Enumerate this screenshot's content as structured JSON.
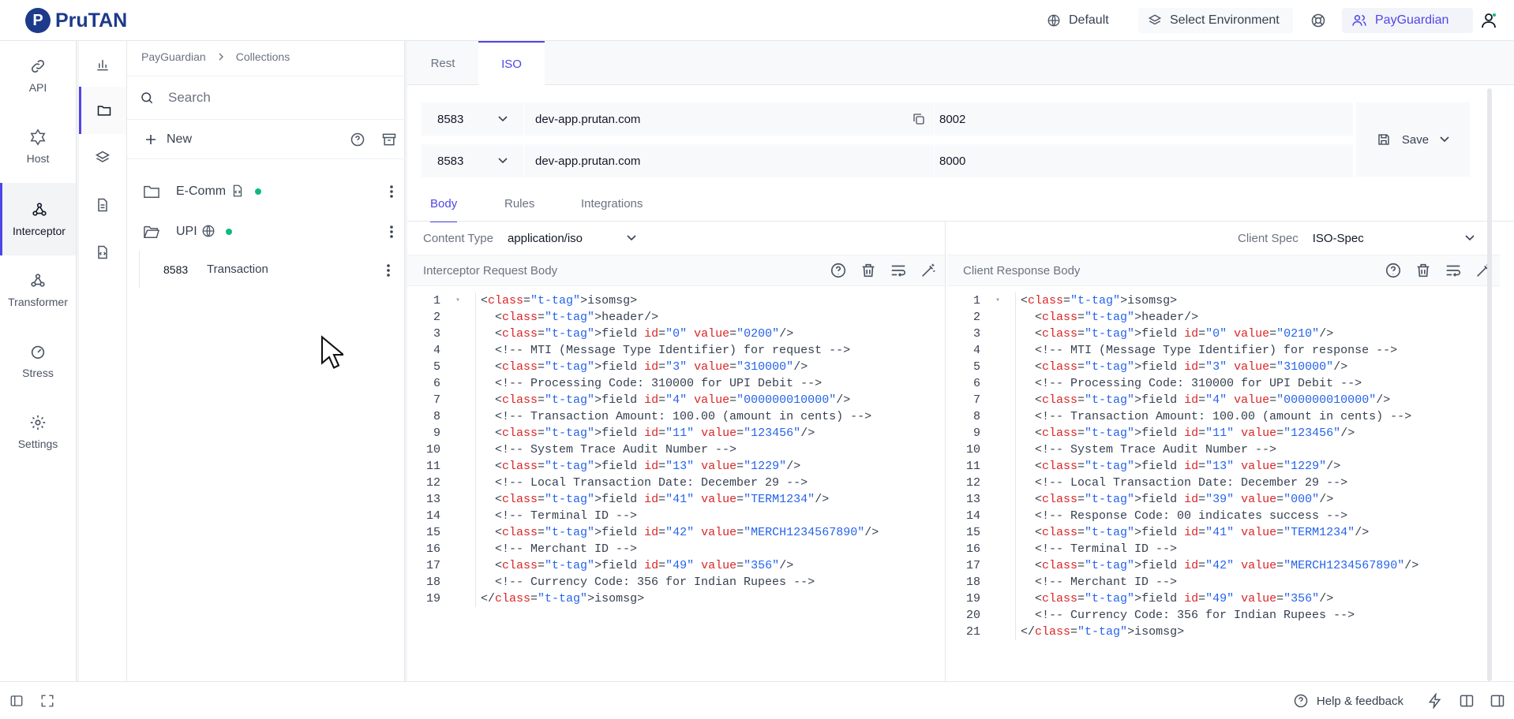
{
  "topbar": {
    "logo_text": "PruTAN",
    "logo_mark": "P",
    "default_label": "Default",
    "environment_label": "Select Environment",
    "workspace_label": "PayGuardian"
  },
  "leftnav": [
    {
      "label": "API",
      "icon": "link-icon"
    },
    {
      "label": "Host",
      "icon": "host-icon"
    },
    {
      "label": "Interceptor",
      "icon": "interceptor-icon"
    },
    {
      "label": "Transformer",
      "icon": "transformer-icon"
    },
    {
      "label": "Stress",
      "icon": "gauge-icon"
    },
    {
      "label": "Settings",
      "icon": "gear-icon"
    }
  ],
  "collections": {
    "breadcrumb": [
      "PayGuardian",
      "Collections"
    ],
    "search_placeholder": "Search",
    "new_label": "New",
    "items": [
      {
        "name": "E-Comm"
      },
      {
        "name": "UPI"
      }
    ],
    "child": {
      "port": "8583",
      "name": "Transaction"
    }
  },
  "protocol_tabs": [
    "Rest",
    "ISO"
  ],
  "interceptor": {
    "port": "8583",
    "host": "dev-app.prutan.com",
    "target_port": "8002"
  },
  "client": {
    "port": "8583",
    "host": "dev-app.prutan.com",
    "target_port": "8000"
  },
  "save_label": "Save",
  "sub_tabs": [
    "Body",
    "Rules",
    "Integrations"
  ],
  "content_type_label": "Content Type",
  "content_type_value": "application/iso",
  "client_spec_label": "Client Spec",
  "client_spec_value": "ISO-Spec",
  "request_panel_title": "Interceptor Request Body",
  "response_panel_title": "Client Response Body",
  "request_body": [
    "<isomsg>",
    "  <header/>",
    "  <field id=\"0\" value=\"0200\"/>",
    "  <!-- MTI (Message Type Identifier) for request -->",
    "  <field id=\"3\" value=\"310000\"/>",
    "  <!-- Processing Code: 310000 for UPI Debit -->",
    "  <field id=\"4\" value=\"000000010000\"/>",
    "  <!-- Transaction Amount: 100.00 (amount in cents) -->",
    "  <field id=\"11\" value=\"123456\"/>",
    "  <!-- System Trace Audit Number -->",
    "  <field id=\"13\" value=\"1229\"/>",
    "  <!-- Local Transaction Date: December 29 -->",
    "  <field id=\"41\" value=\"TERM1234\"/>",
    "  <!-- Terminal ID -->",
    "  <field id=\"42\" value=\"MERCH1234567890\"/>",
    "  <!-- Merchant ID -->",
    "  <field id=\"49\" value=\"356\"/>",
    "  <!-- Currency Code: 356 for Indian Rupees -->",
    "</isomsg>"
  ],
  "response_body": [
    "<isomsg>",
    "  <header/>",
    "  <field id=\"0\" value=\"0210\"/>",
    "  <!-- MTI (Message Type Identifier) for response -->",
    "  <field id=\"3\" value=\"310000\"/>",
    "  <!-- Processing Code: 310000 for UPI Debit -->",
    "  <field id=\"4\" value=\"000000010000\"/>",
    "  <!-- Transaction Amount: 100.00 (amount in cents) -->",
    "  <field id=\"11\" value=\"123456\"/>",
    "  <!-- System Trace Audit Number -->",
    "  <field id=\"13\" value=\"1229\"/>",
    "  <!-- Local Transaction Date: December 29 -->",
    "  <field id=\"39\" value=\"000\"/>",
    "  <!-- Response Code: 00 indicates success -->",
    "  <field id=\"41\" value=\"TERM1234\"/>",
    "  <!-- Terminal ID -->",
    "  <field id=\"42\" value=\"MERCH1234567890\"/>",
    "  <!-- Merchant ID -->",
    "  <field id=\"49\" value=\"356\"/>",
    "  <!-- Currency Code: 356 for Indian Rupees -->",
    "</isomsg>"
  ],
  "footer": {
    "help_label": "Help & feedback"
  },
  "colors": {
    "accent": "#4f46e5",
    "brand": "#1e3a8a",
    "status_dot": "#10b981"
  }
}
